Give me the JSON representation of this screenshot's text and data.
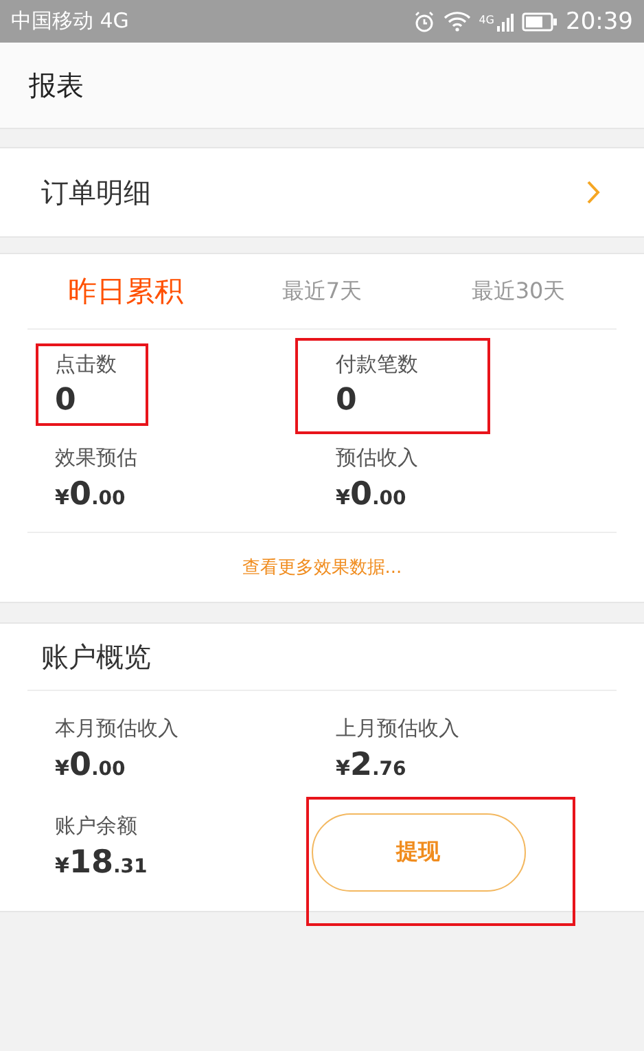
{
  "status_bar": {
    "carrier": "中国移动 4G",
    "network_label": "4G",
    "time": "20:39"
  },
  "header": {
    "title": "报表"
  },
  "order_row": {
    "label": "订单明细"
  },
  "stats_card": {
    "tabs": [
      {
        "label": "昨日累积",
        "selected": true
      },
      {
        "label": "最近7天",
        "selected": false
      },
      {
        "label": "最近30天",
        "selected": false
      }
    ],
    "counts": [
      {
        "label": "点击数",
        "value": "0",
        "highlighted": true
      },
      {
        "label": "付款笔数",
        "value": "0",
        "highlighted": true
      }
    ],
    "amounts": [
      {
        "label": "效果预估",
        "currency": "¥",
        "integer": "0",
        "decimals": ".00"
      },
      {
        "label": "预估收入",
        "currency": "¥",
        "integer": "0",
        "decimals": ".00"
      }
    ],
    "more_link": "查看更多效果数据..."
  },
  "account_card": {
    "title": "账户概览",
    "amounts": [
      {
        "label": "本月预估收入",
        "currency": "¥",
        "integer": "0",
        "decimals": ".00"
      },
      {
        "label": "上月预估收入",
        "currency": "¥",
        "integer": "2",
        "decimals": ".76"
      },
      {
        "label": "账户余额",
        "currency": "¥",
        "integer": "18",
        "decimals": ".31"
      }
    ],
    "withdraw_button": {
      "label": "提现",
      "highlighted": true
    }
  }
}
